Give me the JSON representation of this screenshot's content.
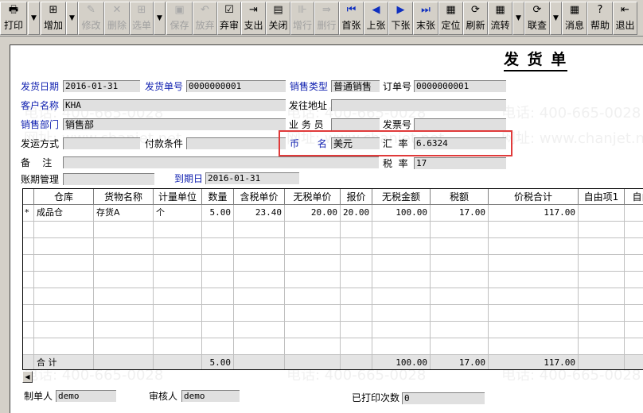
{
  "toolbar": {
    "items": [
      {
        "label": "打印",
        "icon": "printer-icon",
        "enabled": true
      },
      {
        "label": "增加",
        "icon": "add-icon",
        "enabled": true
      },
      {
        "label": "修改",
        "icon": "edit-icon",
        "enabled": false
      },
      {
        "label": "删除",
        "icon": "delete-icon",
        "enabled": false
      },
      {
        "label": "选单",
        "icon": "select-icon",
        "enabled": false
      },
      {
        "label": "保存",
        "icon": "save-icon",
        "enabled": false
      },
      {
        "label": "放弃",
        "icon": "undo-icon",
        "enabled": false
      },
      {
        "label": "弃审",
        "icon": "unaudit-icon",
        "enabled": true
      },
      {
        "label": "支出",
        "icon": "expense-icon",
        "enabled": true
      },
      {
        "label": "关闭",
        "icon": "close-doc-icon",
        "enabled": true
      },
      {
        "label": "增行",
        "icon": "add-row-icon",
        "enabled": false
      },
      {
        "label": "删行",
        "icon": "delete-row-icon",
        "enabled": false
      },
      {
        "label": "首张",
        "icon": "first-icon",
        "enabled": true
      },
      {
        "label": "上张",
        "icon": "prev-icon",
        "enabled": true
      },
      {
        "label": "下张",
        "icon": "next-icon",
        "enabled": true
      },
      {
        "label": "末张",
        "icon": "last-icon",
        "enabled": true
      },
      {
        "label": "定位",
        "icon": "locate-icon",
        "enabled": true
      },
      {
        "label": "刷新",
        "icon": "refresh-icon",
        "enabled": true
      },
      {
        "label": "流转",
        "icon": "flow-icon",
        "enabled": true
      },
      {
        "label": "联查",
        "icon": "query-icon",
        "enabled": true
      },
      {
        "label": "消息",
        "icon": "message-icon",
        "enabled": true
      },
      {
        "label": "帮助",
        "icon": "help-icon",
        "enabled": true
      },
      {
        "label": "退出",
        "icon": "exit-icon",
        "enabled": true
      }
    ]
  },
  "title": "发 货 单",
  "header": {
    "ship_date": {
      "label": "发货日期",
      "value": "2016-01-31"
    },
    "ship_no": {
      "label": "发货单号",
      "value": "0000000001"
    },
    "sale_type": {
      "label": "销售类型",
      "value": "普通销售"
    },
    "order_no": {
      "label": "订单号",
      "value": "0000000001"
    },
    "customer": {
      "label": "客户名称",
      "value": "KHA"
    },
    "ship_address": {
      "label": "发往地址",
      "value": ""
    },
    "dept": {
      "label": "销售部门",
      "value": "销售部"
    },
    "salesman": {
      "label": "业 务 员",
      "value": ""
    },
    "invoice_no": {
      "label": "发票号",
      "value": ""
    },
    "ship_method": {
      "label": "发运方式",
      "value": ""
    },
    "pay_terms": {
      "label": "付款条件",
      "value": ""
    },
    "currency": {
      "label": "币      名",
      "value": "美元"
    },
    "exchange_rate": {
      "label": "汇  率",
      "value": "6.6324"
    },
    "remark": {
      "label": "备    注",
      "value": ""
    },
    "tax_rate": {
      "label": "税  率",
      "value": "17"
    },
    "account_period": {
      "label": "账期管理",
      "value": ""
    },
    "due_date": {
      "label": "到期日",
      "value": "2016-01-31"
    }
  },
  "grid": {
    "columns": [
      "仓库",
      "货物名称",
      "计量单位",
      "数量",
      "含税单价",
      "无税单价",
      "报价",
      "无税金额",
      "税额",
      "价税合计",
      "自由项1",
      "自由"
    ],
    "rows": [
      [
        "*",
        "成品仓",
        "存货A",
        "个",
        "5.00",
        "23.40",
        "20.00",
        "20.00",
        "100.00",
        "17.00",
        "117.00",
        "",
        ""
      ]
    ],
    "total": {
      "label": "合  计",
      "qty": "5.00",
      "amount": "100.00",
      "tax": "17.00",
      "total": "117.00"
    }
  },
  "footer": {
    "maker": {
      "label": "制单人",
      "value": "demo"
    },
    "auditor": {
      "label": "审核人",
      "value": "demo"
    },
    "print_count": {
      "label": "已打印次数",
      "value": "0"
    }
  },
  "watermark": {
    "phone": "电话: 400-665-0028",
    "site": "网址: www.chanjet.net"
  },
  "colors": {
    "highlight_box": "#e03a3a",
    "blue_label": "#1020b0"
  }
}
